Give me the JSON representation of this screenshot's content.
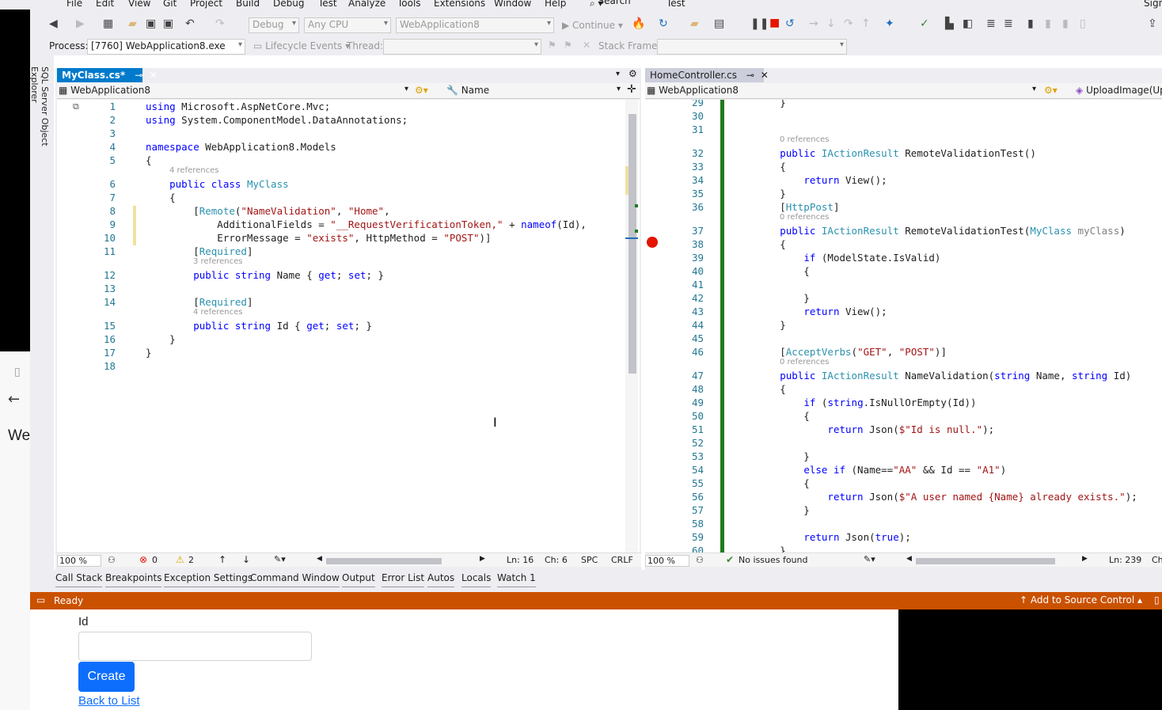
{
  "menu": [
    "File",
    "Edit",
    "View",
    "Git",
    "Project",
    "Build",
    "Debug",
    "Test",
    "Analyze",
    "Tools",
    "Extensions",
    "Window",
    "Help",
    "Search",
    "Test",
    "Sign"
  ],
  "toolbar": {
    "config": "Debug",
    "platform": "Any CPU",
    "startup": "WebApplication8",
    "continue_label": "Continue"
  },
  "debug_bar": {
    "process_label": "Process:",
    "process_value": "[7760] WebApplication8.exe",
    "lifecycle_label": "Lifecycle Events",
    "thread_label": "Thread:",
    "stack_label": "Stack Frame:"
  },
  "side_tab": "SQL Server Object Explorer",
  "browser": {
    "title_partial": "We",
    "id_label": "Id",
    "create_label": "Create",
    "back_link": "Back to List"
  },
  "left_editor": {
    "tab": "MyClass.cs*",
    "nav_project": "WebApplication8",
    "nav_member": "Name",
    "lines": [
      {
        "n": "1",
        "html": "<span class='k'>using</span> Microsoft.AspNetCore.Mvc;"
      },
      {
        "n": "2",
        "html": "<span class='k'>using</span> System.ComponentModel.DataAnnotations;"
      },
      {
        "n": "3",
        "html": ""
      },
      {
        "n": "4",
        "html": "<span class='k'>namespace</span> WebApplication8.Models"
      },
      {
        "n": "5",
        "html": "{"
      },
      {
        "n": "6",
        "html": "    <span class='k'>public class</span> <span class='t'>MyClass</span>",
        "ref": "4 references"
      },
      {
        "n": "7",
        "html": "    {"
      },
      {
        "n": "8",
        "html": "        [<span class='t'>Remote</span>(<span class='s'>\"NameValidation\"</span>, <span class='s'>\"Home\"</span>,"
      },
      {
        "n": "9",
        "html": "            AdditionalFields = <span class='s'>\"__RequestVerificationToken,\"</span> + <span class='k'>nameof</span>(Id),"
      },
      {
        "n": "10",
        "html": "            ErrorMessage = <span class='s'>\"exists\"</span>, HttpMethod = <span class='s'>\"POST\"</span>)]"
      },
      {
        "n": "11",
        "html": "        [<span class='t'>Required</span>]"
      },
      {
        "n": "12",
        "html": "        <span class='k'>public string</span> Name { <span class='k'>get</span>; <span class='k'>set</span>; }",
        "ref": "3 references"
      },
      {
        "n": "13",
        "html": ""
      },
      {
        "n": "14",
        "html": "        [<span class='t'>Required</span>]"
      },
      {
        "n": "15",
        "html": "        <span class='k'>public string</span> Id { <span class='k'>get</span>; <span class='k'>set</span>; }",
        "ref": "4 references"
      },
      {
        "n": "16",
        "html": "    }"
      },
      {
        "n": "17",
        "html": "}"
      },
      {
        "n": "18",
        "html": ""
      }
    ],
    "status": {
      "zoom": "100 %",
      "errors": "0",
      "warnings": "2",
      "ln": "Ln: 16",
      "ch": "Ch: 6",
      "spc": "SPC",
      "crlf": "CRLF"
    }
  },
  "right_editor": {
    "tab": "HomeController.cs",
    "nav_project": "WebApplication8",
    "nav_member": "UploadImage(Up",
    "lines": [
      {
        "n": "29",
        "html": "        }"
      },
      {
        "n": "30",
        "html": ""
      },
      {
        "n": "31",
        "html": ""
      },
      {
        "n": "32",
        "html": "        <span class='k'>public</span> <span class='t'>IActionResult</span> RemoteValidationTest()",
        "ref": "0 references"
      },
      {
        "n": "33",
        "html": "        {"
      },
      {
        "n": "34",
        "html": "            <span class='k'>return</span> View();"
      },
      {
        "n": "35",
        "html": "        }"
      },
      {
        "n": "36",
        "html": "        [<span class='t'>HttpPost</span>]"
      },
      {
        "n": "37",
        "html": "        <span class='k'>public</span> <span class='t'>IActionResult</span> RemoteValidationTest(<span class='t'>MyClass</span> <span style='color:#808080'>myClass</span>)",
        "ref": "0 references"
      },
      {
        "n": "38",
        "html": "        {"
      },
      {
        "n": "39",
        "html": "            <span class='k'>if</span> (ModelState.IsValid)"
      },
      {
        "n": "40",
        "html": "            {"
      },
      {
        "n": "41",
        "html": ""
      },
      {
        "n": "42",
        "html": "            }"
      },
      {
        "n": "43",
        "html": "            <span class='k'>return</span> View();"
      },
      {
        "n": "44",
        "html": "        }"
      },
      {
        "n": "45",
        "html": ""
      },
      {
        "n": "46",
        "html": "        [<span class='t'>AcceptVerbs</span>(<span class='s'>\"GET\"</span>, <span class='s'>\"POST\"</span>)]"
      },
      {
        "n": "47",
        "html": "        <span class='k'>public</span> <span class='t'>IActionResult</span> NameValidation(<span class='k'>string</span> Name, <span class='k'>string</span> Id)",
        "ref": "0 references"
      },
      {
        "n": "48",
        "html": "        {"
      },
      {
        "n": "49",
        "html": "            <span class='k'>if</span> (<span class='k'>string</span>.IsNullOrEmpty(Id))"
      },
      {
        "n": "50",
        "html": "            {"
      },
      {
        "n": "51",
        "html": "                <span class='k'>return</span> Json(<span class='s'>$\"Id is null.\"</span>);"
      },
      {
        "n": "52",
        "html": ""
      },
      {
        "n": "53",
        "html": "            }"
      },
      {
        "n": "54",
        "html": "            <span class='k'>else if</span> (Name==<span class='s'>\"AA\"</span> &amp;&amp; Id == <span class='s'>\"A1\"</span>)"
      },
      {
        "n": "55",
        "html": "            {"
      },
      {
        "n": "56",
        "html": "                <span class='k'>return</span> Json(<span class='s'>$\"A user named {Name} already exists.\"</span>);"
      },
      {
        "n": "57",
        "html": "            }"
      },
      {
        "n": "58",
        "html": ""
      },
      {
        "n": "59",
        "html": "            <span class='k'>return</span> Json(<span class='k'>true</span>);"
      },
      {
        "n": "60",
        "html": "        }"
      }
    ],
    "status": {
      "zoom": "100 %",
      "issues": "No issues found",
      "ln": "Ln: 239",
      "ch": "Ch"
    }
  },
  "tool_tabs": [
    "Call Stack",
    "Breakpoints",
    "Exception Settings",
    "Command Window",
    "Output",
    "Error List",
    "Autos",
    "Locals",
    "Watch 1"
  ],
  "statusbar": {
    "ready": "Ready",
    "source_control": "Add to Source Control"
  },
  "colors": {
    "accent": "#007acc",
    "status": "#ca5100",
    "create": "#0d6efd"
  }
}
